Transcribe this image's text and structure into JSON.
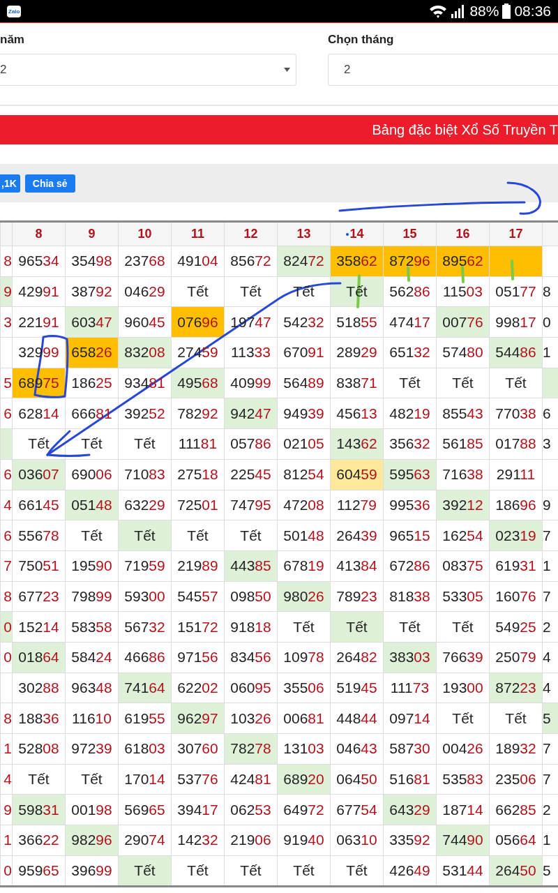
{
  "status_bar": {
    "app_icon": "Zalo",
    "battery": "88%",
    "time": "08:36"
  },
  "filters": [
    {
      "label": "năm",
      "value": "2",
      "dropdown": true
    },
    {
      "label": "Chọn tháng",
      "value": "2",
      "dropdown": false
    }
  ],
  "banner": "Bảng đặc biệt Xổ Số Truyền T",
  "share_buttons": [
    ",1K",
    "Chia sẻ"
  ],
  "table": {
    "columns": [
      {},
      {
        "label": "8"
      },
      {
        "label": "9"
      },
      {
        "label": "10"
      },
      {
        "label": "11"
      },
      {
        "label": "12"
      },
      {
        "label": "13"
      },
      {
        "label": "14"
      },
      {
        "label": "15"
      },
      {
        "label": "16"
      },
      {
        "label": "17"
      },
      {}
    ],
    "rows": [
      {
        "cells": [
          {
            "tail": "8",
            "color": "#ffffff"
          },
          {
            "lead": "965",
            "tail": "34",
            "color": "#ffffff"
          },
          {
            "lead": "354",
            "tail": "98",
            "color": "#ffffff"
          },
          {
            "lead": "237",
            "tail": "68",
            "color": "#ffffff"
          },
          {
            "lead": "491",
            "tail": "04",
            "color": "#ffffff"
          },
          {
            "lead": "856",
            "tail": "72",
            "color": "#ffffff"
          },
          {
            "lead": "824",
            "tail": "72",
            "color": "#dff0d8"
          },
          {
            "lead": "358",
            "tail": "62",
            "color": "#ffbf00"
          },
          {
            "lead": "872",
            "tail": "96",
            "color": "#ffbf00"
          },
          {
            "lead": "895",
            "tail": "62",
            "color": "#ffbf00"
          },
          {
            "color": "#ffbf00"
          },
          {
            "color": "#ffffff"
          }
        ]
      },
      {
        "cells": [
          {
            "tail": "9",
            "color": "#dff0d8"
          },
          {
            "lead": "429",
            "tail": "91",
            "color": "#ffffff"
          },
          {
            "lead": "387",
            "tail": "92",
            "color": "#ffffff"
          },
          {
            "lead": "046",
            "tail": "29",
            "color": "#ffffff"
          },
          {
            "lead": "Tết",
            "color": "#ffffff"
          },
          {
            "lead": "Tết",
            "color": "#ffffff"
          },
          {
            "lead": "Tết",
            "color": "#ffffff"
          },
          {
            "lead": "Tết",
            "color": "#dff0d8"
          },
          {
            "lead": "562",
            "tail": "86",
            "color": "#ffffff"
          },
          {
            "lead": "115",
            "tail": "03",
            "color": "#ffffff"
          },
          {
            "lead": "051",
            "tail": "77",
            "color": "#ffffff"
          },
          {
            "lead": "8",
            "color": "#ffffff"
          }
        ]
      },
      {
        "cells": [
          {
            "tail": "3",
            "color": "#ffffff"
          },
          {
            "lead": "221",
            "tail": "91",
            "color": "#ffffff"
          },
          {
            "lead": "603",
            "tail": "47",
            "color": "#dff0d8"
          },
          {
            "lead": "960",
            "tail": "45",
            "color": "#ffffff"
          },
          {
            "lead": "076",
            "tail": "96",
            "color": "#ffbf00"
          },
          {
            "lead": "197",
            "tail": "47",
            "color": "#ffffff"
          },
          {
            "lead": "542",
            "tail": "32",
            "color": "#ffffff"
          },
          {
            "lead": "518",
            "tail": "55",
            "color": "#ffffff"
          },
          {
            "lead": "474",
            "tail": "17",
            "color": "#ffffff"
          },
          {
            "lead": "007",
            "tail": "76",
            "color": "#dff0d8"
          },
          {
            "lead": "998",
            "tail": "17",
            "color": "#ffffff"
          },
          {
            "lead": "0",
            "color": "#ffffff"
          }
        ]
      },
      {
        "cells": [
          {
            "color": "#ffffff"
          },
          {
            "lead": "329",
            "tail": "99",
            "color": "#ffffff"
          },
          {
            "lead": "658",
            "tail": "26",
            "color": "#ffbf00"
          },
          {
            "lead": "832",
            "tail": "08",
            "color": "#dff0d8"
          },
          {
            "lead": "274",
            "tail": "59",
            "color": "#ffffff"
          },
          {
            "lead": "113",
            "tail": "33",
            "color": "#ffffff"
          },
          {
            "lead": "670",
            "tail": "91",
            "color": "#ffffff"
          },
          {
            "lead": "289",
            "tail": "29",
            "color": "#ffffff"
          },
          {
            "lead": "651",
            "tail": "32",
            "color": "#ffffff"
          },
          {
            "lead": "574",
            "tail": "80",
            "color": "#ffffff"
          },
          {
            "lead": "544",
            "tail": "86",
            "color": "#dff0d8"
          },
          {
            "lead": "1",
            "color": "#ffffff"
          }
        ]
      },
      {
        "cells": [
          {
            "tail": "5",
            "color": "#ffffff"
          },
          {
            "lead": "689",
            "tail": "75",
            "color": "#ffbf00"
          },
          {
            "lead": "186",
            "tail": "25",
            "color": "#ffffff"
          },
          {
            "lead": "934",
            "tail": "81",
            "color": "#ffffff"
          },
          {
            "lead": "495",
            "tail": "68",
            "color": "#dff0d8"
          },
          {
            "lead": "409",
            "tail": "99",
            "color": "#ffffff"
          },
          {
            "lead": "564",
            "tail": "89",
            "color": "#ffffff"
          },
          {
            "lead": "838",
            "tail": "71",
            "color": "#ffffff"
          },
          {
            "lead": "Tết",
            "color": "#ffffff"
          },
          {
            "lead": "Tết",
            "color": "#ffffff"
          },
          {
            "lead": "Tết",
            "color": "#ffffff"
          },
          {
            "color": "#dff0d8"
          }
        ]
      },
      {
        "cells": [
          {
            "tail": "6",
            "color": "#ffffff"
          },
          {
            "lead": "628",
            "tail": "14",
            "color": "#ffffff"
          },
          {
            "lead": "666",
            "tail": "81",
            "color": "#ffffff"
          },
          {
            "lead": "392",
            "tail": "52",
            "color": "#ffffff"
          },
          {
            "lead": "782",
            "tail": "92",
            "color": "#ffffff"
          },
          {
            "lead": "942",
            "tail": "47",
            "color": "#dff0d8"
          },
          {
            "lead": "949",
            "tail": "39",
            "color": "#ffffff"
          },
          {
            "lead": "456",
            "tail": "13",
            "color": "#ffffff"
          },
          {
            "lead": "482",
            "tail": "19",
            "color": "#ffffff"
          },
          {
            "lead": "855",
            "tail": "43",
            "color": "#ffffff"
          },
          {
            "lead": "770",
            "tail": "38",
            "color": "#ffffff"
          },
          {
            "lead": "6",
            "color": "#ffffff"
          }
        ]
      },
      {
        "cells": [
          {
            "color": "#dff0d8"
          },
          {
            "lead": "Tết",
            "color": "#ffffff"
          },
          {
            "lead": "Tết",
            "color": "#ffffff"
          },
          {
            "lead": "Tết",
            "color": "#ffffff"
          },
          {
            "lead": "111",
            "tail": "81",
            "color": "#ffffff"
          },
          {
            "lead": "057",
            "tail": "86",
            "color": "#ffffff"
          },
          {
            "lead": "021",
            "tail": "05",
            "color": "#ffffff"
          },
          {
            "lead": "143",
            "tail": "62",
            "color": "#dff0d8"
          },
          {
            "lead": "356",
            "tail": "32",
            "color": "#ffffff"
          },
          {
            "lead": "561",
            "tail": "85",
            "color": "#ffffff"
          },
          {
            "lead": "017",
            "tail": "88",
            "color": "#ffffff"
          },
          {
            "lead": "3",
            "color": "#ffffff"
          }
        ]
      },
      {
        "cells": [
          {
            "tail": "6",
            "color": "#ffffff"
          },
          {
            "lead": "036",
            "tail": "07",
            "color": "#dff0d8"
          },
          {
            "lead": "690",
            "tail": "06",
            "color": "#ffffff"
          },
          {
            "lead": "710",
            "tail": "83",
            "color": "#ffffff"
          },
          {
            "lead": "275",
            "tail": "18",
            "color": "#ffffff"
          },
          {
            "lead": "225",
            "tail": "45",
            "color": "#ffffff"
          },
          {
            "lead": "812",
            "tail": "54",
            "color": "#ffffff"
          },
          {
            "lead": "604",
            "tail": "59",
            "color": "#ffe89a"
          },
          {
            "lead": "595",
            "tail": "63",
            "color": "#dff0d8"
          },
          {
            "lead": "716",
            "tail": "38",
            "color": "#ffffff"
          },
          {
            "lead": "291",
            "tail": "11",
            "color": "#ffffff"
          },
          {
            "color": "#ffffff"
          }
        ]
      },
      {
        "cells": [
          {
            "tail": "4",
            "color": "#ffffff"
          },
          {
            "lead": "661",
            "tail": "45",
            "color": "#ffffff"
          },
          {
            "lead": "051",
            "tail": "48",
            "color": "#dff0d8"
          },
          {
            "lead": "632",
            "tail": "29",
            "color": "#ffffff"
          },
          {
            "lead": "725",
            "tail": "01",
            "color": "#ffffff"
          },
          {
            "lead": "747",
            "tail": "95",
            "color": "#ffffff"
          },
          {
            "lead": "472",
            "tail": "08",
            "color": "#ffffff"
          },
          {
            "lead": "112",
            "tail": "79",
            "color": "#ffffff"
          },
          {
            "lead": "995",
            "tail": "36",
            "color": "#ffffff"
          },
          {
            "lead": "392",
            "tail": "12",
            "color": "#dff0d8"
          },
          {
            "lead": "186",
            "tail": "96",
            "color": "#ffffff"
          },
          {
            "lead": "9",
            "color": "#ffffff"
          }
        ]
      },
      {
        "cells": [
          {
            "tail": "6",
            "color": "#ffffff"
          },
          {
            "lead": "556",
            "tail": "78",
            "color": "#ffffff"
          },
          {
            "lead": "Tết",
            "color": "#ffffff"
          },
          {
            "lead": "Tết",
            "color": "#dff0d8"
          },
          {
            "lead": "Tết",
            "color": "#ffffff"
          },
          {
            "lead": "Tết",
            "color": "#ffffff"
          },
          {
            "lead": "501",
            "tail": "48",
            "color": "#ffffff"
          },
          {
            "lead": "264",
            "tail": "39",
            "color": "#ffffff"
          },
          {
            "lead": "965",
            "tail": "15",
            "color": "#ffffff"
          },
          {
            "lead": "162",
            "tail": "54",
            "color": "#ffffff"
          },
          {
            "lead": "023",
            "tail": "19",
            "color": "#dff0d8"
          },
          {
            "lead": "7",
            "color": "#ffffff"
          }
        ]
      },
      {
        "cells": [
          {
            "tail": "7",
            "color": "#ffffff"
          },
          {
            "lead": "750",
            "tail": "51",
            "color": "#ffffff"
          },
          {
            "lead": "195",
            "tail": "90",
            "color": "#ffffff"
          },
          {
            "lead": "719",
            "tail": "59",
            "color": "#ffffff"
          },
          {
            "lead": "219",
            "tail": "89",
            "color": "#ffffff"
          },
          {
            "lead": "443",
            "tail": "85",
            "color": "#dff0d8"
          },
          {
            "lead": "678",
            "tail": "19",
            "color": "#ffffff"
          },
          {
            "lead": "413",
            "tail": "84",
            "color": "#ffffff"
          },
          {
            "lead": "672",
            "tail": "86",
            "color": "#ffffff"
          },
          {
            "lead": "083",
            "tail": "75",
            "color": "#ffffff"
          },
          {
            "lead": "619",
            "tail": "31",
            "color": "#ffffff"
          },
          {
            "lead": "1",
            "color": "#ffffff"
          }
        ]
      },
      {
        "cells": [
          {
            "tail": "8",
            "color": "#ffffff"
          },
          {
            "lead": "677",
            "tail": "23",
            "color": "#ffffff"
          },
          {
            "lead": "798",
            "tail": "99",
            "color": "#ffffff"
          },
          {
            "lead": "593",
            "tail": "00",
            "color": "#ffffff"
          },
          {
            "lead": "545",
            "tail": "57",
            "color": "#ffffff"
          },
          {
            "lead": "098",
            "tail": "50",
            "color": "#ffffff"
          },
          {
            "lead": "980",
            "tail": "26",
            "color": "#dff0d8"
          },
          {
            "lead": "789",
            "tail": "23",
            "color": "#ffffff"
          },
          {
            "lead": "818",
            "tail": "38",
            "color": "#ffffff"
          },
          {
            "lead": "533",
            "tail": "05",
            "color": "#ffffff"
          },
          {
            "lead": "160",
            "tail": "76",
            "color": "#ffffff"
          },
          {
            "lead": "7",
            "color": "#ffffff"
          }
        ]
      },
      {
        "cells": [
          {
            "tail": "0",
            "color": "#dff0d8"
          },
          {
            "lead": "152",
            "tail": "14",
            "color": "#ffffff"
          },
          {
            "lead": "583",
            "tail": "58",
            "color": "#ffffff"
          },
          {
            "lead": "567",
            "tail": "32",
            "color": "#ffffff"
          },
          {
            "lead": "151",
            "tail": "72",
            "color": "#ffffff"
          },
          {
            "lead": "918",
            "tail": "18",
            "color": "#ffffff"
          },
          {
            "lead": "Tết",
            "color": "#ffffff"
          },
          {
            "lead": "Tết",
            "color": "#dff0d8"
          },
          {
            "lead": "Tết",
            "color": "#ffffff"
          },
          {
            "lead": "Tết",
            "color": "#ffffff"
          },
          {
            "lead": "549",
            "tail": "25",
            "color": "#ffffff"
          },
          {
            "lead": "2",
            "color": "#ffffff"
          }
        ]
      },
      {
        "cells": [
          {
            "tail": "0",
            "color": "#ffffff"
          },
          {
            "lead": "018",
            "tail": "64",
            "color": "#dff0d8"
          },
          {
            "lead": "584",
            "tail": "24",
            "color": "#ffffff"
          },
          {
            "lead": "466",
            "tail": "86",
            "color": "#ffffff"
          },
          {
            "lead": "971",
            "tail": "56",
            "color": "#ffffff"
          },
          {
            "lead": "834",
            "tail": "56",
            "color": "#ffffff"
          },
          {
            "lead": "109",
            "tail": "78",
            "color": "#ffffff"
          },
          {
            "lead": "264",
            "tail": "82",
            "color": "#ffffff"
          },
          {
            "lead": "383",
            "tail": "03",
            "color": "#dff0d8"
          },
          {
            "lead": "766",
            "tail": "39",
            "color": "#ffffff"
          },
          {
            "lead": "250",
            "tail": "79",
            "color": "#ffffff"
          },
          {
            "lead": "4",
            "color": "#ffffff"
          }
        ]
      },
      {
        "cells": [
          {
            "color": "#ffffff"
          },
          {
            "lead": "302",
            "tail": "88",
            "color": "#ffffff"
          },
          {
            "lead": "963",
            "tail": "48",
            "color": "#ffffff"
          },
          {
            "lead": "741",
            "tail": "64",
            "color": "#dff0d8"
          },
          {
            "lead": "622",
            "tail": "02",
            "color": "#ffffff"
          },
          {
            "lead": "060",
            "tail": "95",
            "color": "#ffffff"
          },
          {
            "lead": "355",
            "tail": "06",
            "color": "#ffffff"
          },
          {
            "lead": "519",
            "tail": "45",
            "color": "#ffffff"
          },
          {
            "lead": "111",
            "tail": "73",
            "color": "#ffffff"
          },
          {
            "lead": "193",
            "tail": "00",
            "color": "#ffffff"
          },
          {
            "lead": "872",
            "tail": "23",
            "color": "#dff0d8"
          },
          {
            "lead": "4",
            "color": "#ffffff"
          }
        ]
      },
      {
        "cells": [
          {
            "tail": "8",
            "color": "#ffffff"
          },
          {
            "lead": "188",
            "tail": "36",
            "color": "#ffffff"
          },
          {
            "lead": "116",
            "tail": "10",
            "color": "#ffffff"
          },
          {
            "lead": "619",
            "tail": "55",
            "color": "#ffffff"
          },
          {
            "lead": "962",
            "tail": "97",
            "color": "#dff0d8"
          },
          {
            "lead": "103",
            "tail": "26",
            "color": "#ffffff"
          },
          {
            "lead": "006",
            "tail": "81",
            "color": "#ffffff"
          },
          {
            "lead": "448",
            "tail": "44",
            "color": "#ffffff"
          },
          {
            "lead": "097",
            "tail": "14",
            "color": "#ffffff"
          },
          {
            "lead": "Tết",
            "color": "#ffffff"
          },
          {
            "lead": "Tết",
            "color": "#ffffff"
          },
          {
            "lead": "5",
            "color": "#dff0d8"
          }
        ]
      },
      {
        "cells": [
          {
            "tail": "1",
            "color": "#ffffff"
          },
          {
            "lead": "528",
            "tail": "08",
            "color": "#ffffff"
          },
          {
            "lead": "972",
            "tail": "39",
            "color": "#ffffff"
          },
          {
            "lead": "618",
            "tail": "03",
            "color": "#ffffff"
          },
          {
            "lead": "307",
            "tail": "60",
            "color": "#ffffff"
          },
          {
            "lead": "782",
            "tail": "78",
            "color": "#dff0d8"
          },
          {
            "lead": "131",
            "tail": "03",
            "color": "#ffffff"
          },
          {
            "lead": "046",
            "tail": "43",
            "color": "#ffffff"
          },
          {
            "lead": "587",
            "tail": "30",
            "color": "#ffffff"
          },
          {
            "lead": "004",
            "tail": "26",
            "color": "#ffffff"
          },
          {
            "lead": "189",
            "tail": "32",
            "color": "#ffffff"
          },
          {
            "lead": "7",
            "color": "#ffffff"
          }
        ]
      },
      {
        "cells": [
          {
            "tail": "4",
            "color": "#ffffff"
          },
          {
            "lead": "Tết",
            "color": "#ffffff"
          },
          {
            "lead": "Tết",
            "color": "#ffffff"
          },
          {
            "lead": "170",
            "tail": "14",
            "color": "#ffffff"
          },
          {
            "lead": "537",
            "tail": "76",
            "color": "#ffffff"
          },
          {
            "lead": "424",
            "tail": "81",
            "color": "#ffffff"
          },
          {
            "lead": "689",
            "tail": "20",
            "color": "#dff0d8"
          },
          {
            "lead": "064",
            "tail": "50",
            "color": "#ffffff"
          },
          {
            "lead": "516",
            "tail": "81",
            "color": "#ffffff"
          },
          {
            "lead": "535",
            "tail": "83",
            "color": "#ffffff"
          },
          {
            "lead": "235",
            "tail": "06",
            "color": "#ffffff"
          },
          {
            "lead": "7",
            "color": "#ffffff"
          }
        ]
      },
      {
        "cells": [
          {
            "tail": "9",
            "color": "#ffffff"
          },
          {
            "lead": "598",
            "tail": "31",
            "color": "#dff0d8"
          },
          {
            "lead": "001",
            "tail": "98",
            "color": "#ffffff"
          },
          {
            "lead": "569",
            "tail": "65",
            "color": "#ffffff"
          },
          {
            "lead": "394",
            "tail": "17",
            "color": "#ffffff"
          },
          {
            "lead": "062",
            "tail": "53",
            "color": "#ffffff"
          },
          {
            "lead": "649",
            "tail": "72",
            "color": "#ffffff"
          },
          {
            "lead": "677",
            "tail": "54",
            "color": "#ffffff"
          },
          {
            "lead": "643",
            "tail": "29",
            "color": "#dff0d8"
          },
          {
            "lead": "187",
            "tail": "14",
            "color": "#ffffff"
          },
          {
            "lead": "662",
            "tail": "85",
            "color": "#ffffff"
          },
          {
            "lead": "2",
            "color": "#ffffff"
          }
        ]
      },
      {
        "cells": [
          {
            "tail": "1",
            "color": "#ffffff"
          },
          {
            "lead": "366",
            "tail": "22",
            "color": "#ffffff"
          },
          {
            "lead": "982",
            "tail": "96",
            "color": "#dff0d8"
          },
          {
            "lead": "290",
            "tail": "74",
            "color": "#ffffff"
          },
          {
            "lead": "142",
            "tail": "32",
            "color": "#ffffff"
          },
          {
            "lead": "219",
            "tail": "06",
            "color": "#ffffff"
          },
          {
            "lead": "919",
            "tail": "40",
            "color": "#ffffff"
          },
          {
            "lead": "063",
            "tail": "10",
            "color": "#ffffff"
          },
          {
            "lead": "335",
            "tail": "92",
            "color": "#ffffff"
          },
          {
            "lead": "744",
            "tail": "90",
            "color": "#dff0d8"
          },
          {
            "lead": "056",
            "tail": "64",
            "color": "#ffffff"
          },
          {
            "lead": "1",
            "color": "#ffffff"
          }
        ]
      },
      {
        "cells": [
          {
            "tail": "0",
            "color": "#ffffff"
          },
          {
            "lead": "959",
            "tail": "65",
            "color": "#ffffff"
          },
          {
            "lead": "396",
            "tail": "99",
            "color": "#ffffff"
          },
          {
            "lead": "Tết",
            "color": "#dff0d8"
          },
          {
            "lead": "Tết",
            "color": "#ffffff"
          },
          {
            "lead": "Tết",
            "color": "#ffffff"
          },
          {
            "lead": "Tết",
            "color": "#ffffff"
          },
          {
            "lead": "Tết",
            "color": "#ffffff"
          },
          {
            "lead": "426",
            "tail": "49",
            "color": "#ffffff"
          },
          {
            "lead": "531",
            "tail": "44",
            "color": "#ffffff"
          },
          {
            "lead": "264",
            "tail": "50",
            "color": "#dff0d8"
          },
          {
            "lead": "5",
            "color": "#ffffff"
          }
        ]
      }
    ]
  }
}
